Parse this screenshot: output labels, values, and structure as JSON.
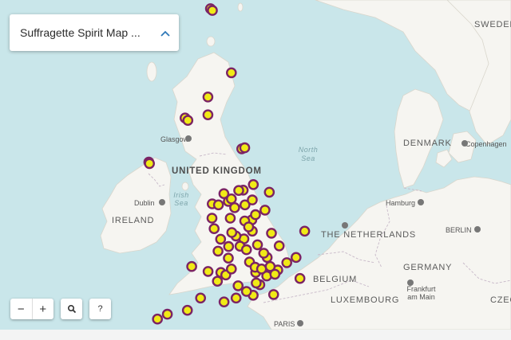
{
  "title_panel": {
    "title": "Suffragette Spirit Map ...",
    "toggle_icon": "chevron-up-icon"
  },
  "controls": {
    "zoom_out": "−",
    "zoom_in": "+",
    "search_icon": "search-icon",
    "help": "?"
  },
  "labels": {
    "united_kingdom": "UNITED KINGDOM",
    "ireland": "IRELAND",
    "denmark": "DENMARK",
    "sweden": "SWEDEN",
    "netherlands": "THE NETHERLANDS",
    "belgium": "BELGIUM",
    "germany": "GERMANY",
    "luxembourg": "LUXEMBOURG",
    "czech": "CZEC",
    "glasgow": "Glasgow",
    "dublin": "Dublin",
    "hamburg": "Hamburg",
    "berlin": "BERLIN",
    "copenhagen": "Copenhagen",
    "frankfurt": "Frankfurt am Main",
    "paris": "PARIS",
    "north_sea": "North Sea",
    "irish_sea": "Irish Sea"
  },
  "marker_style": {
    "fill": "#f1ea16",
    "stroke": "#7b2464"
  },
  "markers": [
    {
      "lon": -3.07,
      "lat": 58.98
    },
    {
      "lon": -2.98,
      "lat": 58.93
    },
    {
      "lon": -2.1,
      "lat": 57.15
    },
    {
      "lon": -3.19,
      "lat": 56.46
    },
    {
      "lon": -3.19,
      "lat": 55.95
    },
    {
      "lon": -4.25,
      "lat": 55.86
    },
    {
      "lon": -4.12,
      "lat": 55.79
    },
    {
      "lon": -1.62,
      "lat": 54.98
    },
    {
      "lon": -1.48,
      "lat": 55.01
    },
    {
      "lon": -5.93,
      "lat": 54.6
    },
    {
      "lon": -5.9,
      "lat": 54.56
    },
    {
      "lon": -2.99,
      "lat": 53.41
    },
    {
      "lon": -2.7,
      "lat": 53.38
    },
    {
      "lon": -2.24,
      "lat": 53.48
    },
    {
      "lon": -2.1,
      "lat": 53.55
    },
    {
      "lon": -1.55,
      "lat": 53.8
    },
    {
      "lon": -1.76,
      "lat": 53.79
    },
    {
      "lon": -1.47,
      "lat": 53.38
    },
    {
      "lon": -1.13,
      "lat": 53.52
    },
    {
      "lon": -0.34,
      "lat": 53.74
    },
    {
      "lon": -1.08,
      "lat": 53.96
    },
    {
      "lon": -2.15,
      "lat": 53.0
    },
    {
      "lon": -1.15,
      "lat": 52.95
    },
    {
      "lon": -0.54,
      "lat": 53.23
    },
    {
      "lon": -1.48,
      "lat": 52.92
    },
    {
      "lon": -1.13,
      "lat": 52.63
    },
    {
      "lon": -1.52,
      "lat": 52.41
    },
    {
      "lon": -1.89,
      "lat": 52.49
    },
    {
      "lon": -2.08,
      "lat": 52.59
    },
    {
      "lon": -2.23,
      "lat": 52.19
    },
    {
      "lon": -2.72,
      "lat": 52.06
    },
    {
      "lon": -0.89,
      "lat": 52.24
    },
    {
      "lon": 0.12,
      "lat": 52.21
    },
    {
      "lon": 1.3,
      "lat": 52.63
    },
    {
      "lon": -0.24,
      "lat": 52.57
    },
    {
      "lon": -1.26,
      "lat": 51.75
    },
    {
      "lon": -2.24,
      "lat": 51.86
    },
    {
      "lon": -2.59,
      "lat": 51.45
    },
    {
      "lon": -2.36,
      "lat": 51.38
    },
    {
      "lon": -3.18,
      "lat": 51.48
    },
    {
      "lon": -3.94,
      "lat": 51.62
    },
    {
      "lon": -0.97,
      "lat": 51.45
    },
    {
      "lon": -0.12,
      "lat": 51.51
    },
    {
      "lon": -0.19,
      "lat": 51.45
    },
    {
      "lon": 0.05,
      "lat": 51.52
    },
    {
      "lon": -0.3,
      "lat": 51.62
    },
    {
      "lon": 0.47,
      "lat": 51.73
    },
    {
      "lon": 1.08,
      "lat": 51.28
    },
    {
      "lon": -0.14,
      "lat": 50.82
    },
    {
      "lon": -1.09,
      "lat": 50.8
    },
    {
      "lon": -1.4,
      "lat": 50.91
    },
    {
      "lon": -1.88,
      "lat": 50.72
    },
    {
      "lon": -3.53,
      "lat": 50.72
    },
    {
      "lon": -4.14,
      "lat": 50.37
    },
    {
      "lon": -5.07,
      "lat": 50.26
    },
    {
      "lon": -5.53,
      "lat": 50.12
    },
    {
      "lon": -1.79,
      "lat": 51.07
    },
    {
      "lon": -2.44,
      "lat": 50.61
    },
    {
      "lon": -0.78,
      "lat": 51.1
    },
    {
      "lon": -0.46,
      "lat": 51.35
    },
    {
      "lon": -0.08,
      "lat": 51.4
    },
    {
      "lon": -3.0,
      "lat": 53.0
    },
    {
      "lon": -2.9,
      "lat": 52.7
    },
    {
      "lon": -0.44,
      "lat": 51.88
    },
    {
      "lon": 0.9,
      "lat": 51.88
    },
    {
      "lon": -0.6,
      "lat": 52.0
    },
    {
      "lon": -1.7,
      "lat": 52.2
    },
    {
      "lon": -2.6,
      "lat": 52.4
    },
    {
      "lon": -1.4,
      "lat": 52.1
    },
    {
      "lon": -1.95,
      "lat": 53.3
    },
    {
      "lon": -0.98,
      "lat": 53.1
    },
    {
      "lon": -1.3,
      "lat": 52.75
    },
    {
      "lon": -2.45,
      "lat": 53.7
    },
    {
      "lon": -1.0,
      "lat": 51.6
    },
    {
      "lon": -0.7,
      "lat": 51.55
    },
    {
      "lon": -0.95,
      "lat": 51.15
    },
    {
      "lon": -2.75,
      "lat": 51.2
    },
    {
      "lon": -2.1,
      "lat": 51.55
    }
  ]
}
